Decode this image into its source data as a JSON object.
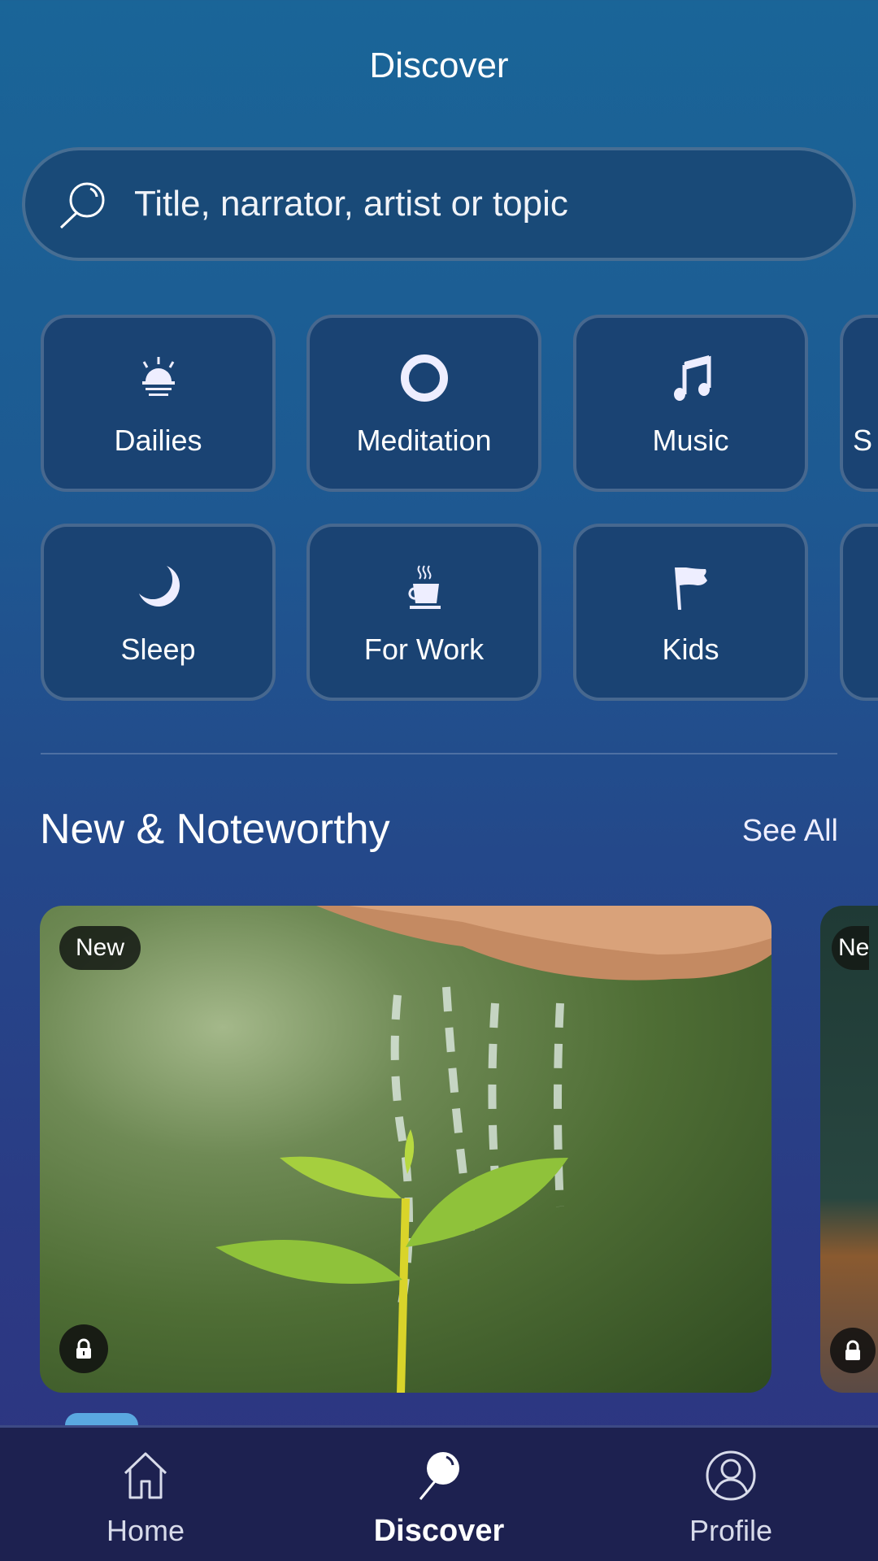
{
  "header": {
    "title": "Discover"
  },
  "search": {
    "placeholder": "Title, narrator, artist or topic"
  },
  "categories": [
    {
      "label": "Dailies",
      "icon": "sunrise-icon"
    },
    {
      "label": "Meditation",
      "icon": "circle-icon"
    },
    {
      "label": "Music",
      "icon": "music-note-icon"
    },
    {
      "label": "S",
      "icon": ""
    },
    {
      "label": "Sleep",
      "icon": "moon-icon"
    },
    {
      "label": "For Work",
      "icon": "coffee-cup-icon"
    },
    {
      "label": "Kids",
      "icon": "flag-icon"
    }
  ],
  "section": {
    "title": "New & Noteworthy",
    "see_all": "See All"
  },
  "cards": [
    {
      "badge": "New",
      "locked": true
    },
    {
      "badge": "Ne",
      "locked": true
    }
  ],
  "tabs": [
    {
      "label": "Home"
    },
    {
      "label": "Discover",
      "active": true
    },
    {
      "label": "Profile"
    }
  ],
  "colors": {
    "background_top": "#1a6598",
    "background_bottom": "#2e3480",
    "tabbar": "#1d2150"
  }
}
